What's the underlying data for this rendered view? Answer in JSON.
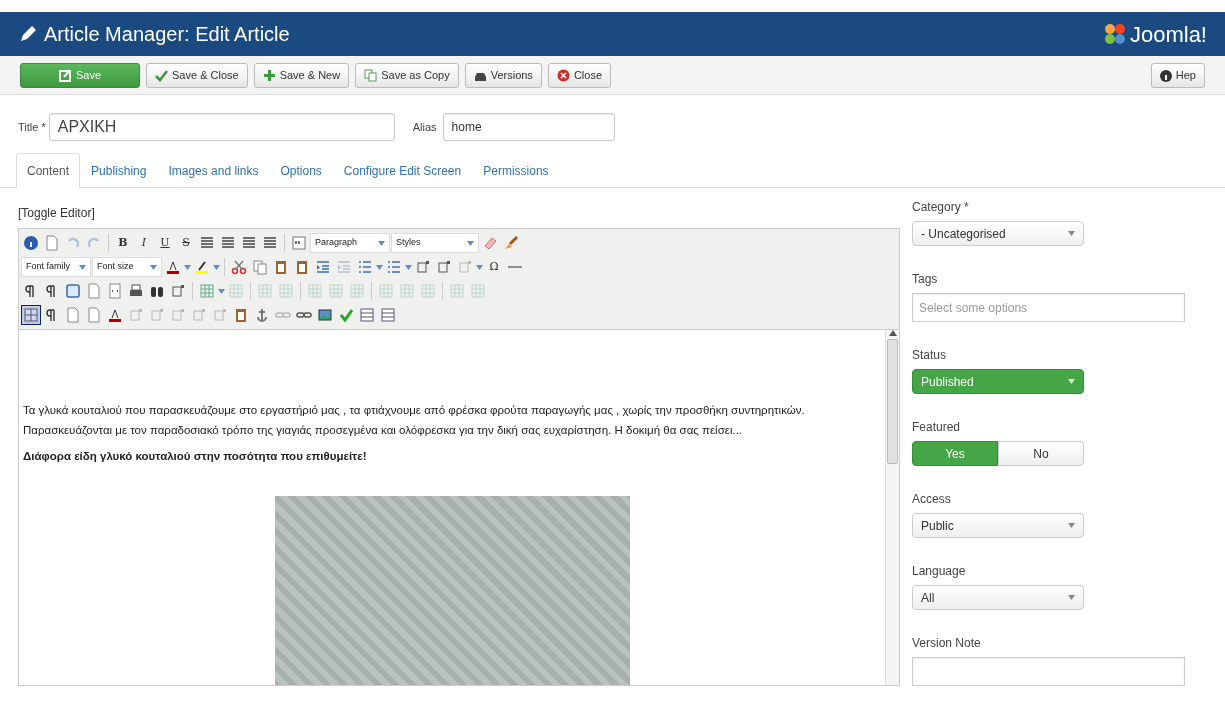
{
  "header": {
    "title": "Article Manager: Edit Article",
    "brand": "Joomla!"
  },
  "toolbar": {
    "buttons": [
      {
        "label": "Save",
        "kind": "save"
      },
      {
        "label": "Save & Close",
        "kind": "check"
      },
      {
        "label": "Save & New",
        "kind": "plus"
      },
      {
        "label": "Save as Copy",
        "kind": "copy"
      },
      {
        "label": "Versions",
        "kind": "versions"
      },
      {
        "label": "Close",
        "kind": "close"
      }
    ],
    "help": "Hep"
  },
  "title_field": {
    "label": "Title *",
    "value": "ΑΡΧΙΚΗ"
  },
  "alias_field": {
    "label": "Alias",
    "value": "home"
  },
  "tabs": [
    {
      "label": "Content",
      "selected": true
    },
    {
      "label": "Publishing",
      "selected": false
    },
    {
      "label": "Images and links",
      "selected": false
    },
    {
      "label": "Options",
      "selected": false
    },
    {
      "label": "Configure Edit Screen",
      "selected": false
    },
    {
      "label": "Permissions",
      "selected": false
    }
  ],
  "editor": {
    "toggle": "[Toggle Editor]",
    "glyphs": [
      {
        "label": "B",
        "kind": "bold"
      },
      {
        "label": "I",
        "kind": "italic"
      },
      {
        "label": "U",
        "kind": "underline"
      },
      {
        "label": "S",
        "kind": "strike"
      },
      {
        "label": "Ω",
        "kind": "plain"
      }
    ],
    "selects": [
      "Paragraph",
      "Styles",
      "Font family",
      "Font size"
    ],
    "paragraph": "Τα γλυκά κουταλιού που παρασκευάζουμε στο εργαστήριό μας , τα φτιάχνουμε από φρέσκα φρούτα παραγωγής μας , χωρίς την προσθήκη συντηρητικών.  Παρασκευάζονται με τον παραδοσιακό τρόπο της γιαγιάς προσεγμένα και ολόφρεσκα για την δική σας ευχαρίστηση. Η δοκιμή θα σας πείσει...",
    "bold_line": "Διάφορα είδη γλυκό κουταλιού στην ποσότητα που επιθυμείτε!"
  },
  "sidebar": [
    {
      "kind": "select",
      "label": "Category *",
      "value": "- Uncategorised"
    },
    {
      "kind": "input",
      "label": "Tags",
      "placeholder": "Select some options"
    },
    {
      "kind": "status",
      "label": "Status",
      "value": "Published"
    },
    {
      "kind": "toggle",
      "label": "Featured",
      "options": [
        {
          "label": "Yes",
          "selected": true
        },
        {
          "label": "No",
          "selected": false
        }
      ]
    },
    {
      "kind": "select",
      "label": "Access",
      "value": "Public"
    },
    {
      "kind": "select",
      "label": "Language",
      "value": "All"
    },
    {
      "kind": "input",
      "label": "Version Note"
    }
  ]
}
